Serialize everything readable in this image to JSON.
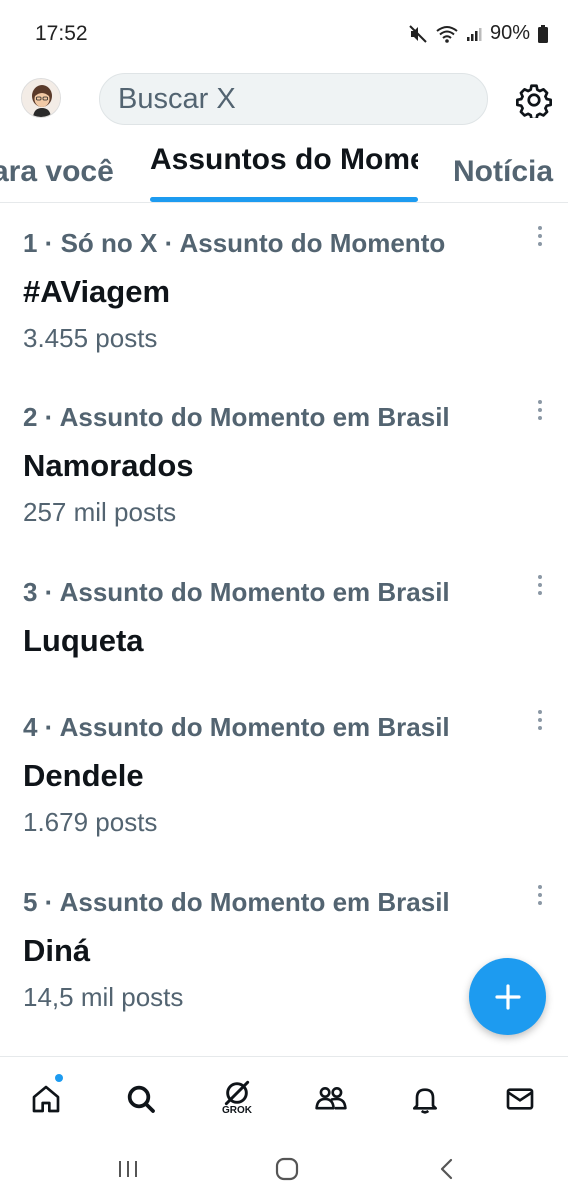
{
  "status": {
    "time": "17:52",
    "battery": "90%"
  },
  "header": {
    "search_placeholder": "Buscar X"
  },
  "tabs": [
    {
      "label": "Para você",
      "visible_text": "ara você"
    },
    {
      "label": "Assuntos do Momento"
    },
    {
      "label": "Notícias",
      "visible_text": "Notícia"
    }
  ],
  "trends": [
    {
      "meta": "1 · Só no X · Assunto do Momento",
      "name": "#AViagem",
      "count": "3.455 posts"
    },
    {
      "meta": "2 · Assunto do Momento em Brasil",
      "name": "Namorados",
      "count": "257 mil posts"
    },
    {
      "meta": "3 · Assunto do Momento em Brasil",
      "name": "Luqueta",
      "count": ""
    },
    {
      "meta": "4 · Assunto do Momento em Brasil",
      "name": "Dendele",
      "count": "1.679 posts"
    },
    {
      "meta": "5 · Assunto do Momento em Brasil",
      "name": "Diná",
      "count": "14,5 mil posts"
    }
  ],
  "bottom_nav": {
    "grok_label": "GROK",
    "items": [
      "home-icon",
      "search-icon",
      "grok-icon",
      "communities-icon",
      "notifications-icon",
      "messages-icon"
    ]
  },
  "colors": {
    "accent": "#1d9bf0",
    "text_primary": "#0f1419",
    "text_secondary": "#536471"
  }
}
